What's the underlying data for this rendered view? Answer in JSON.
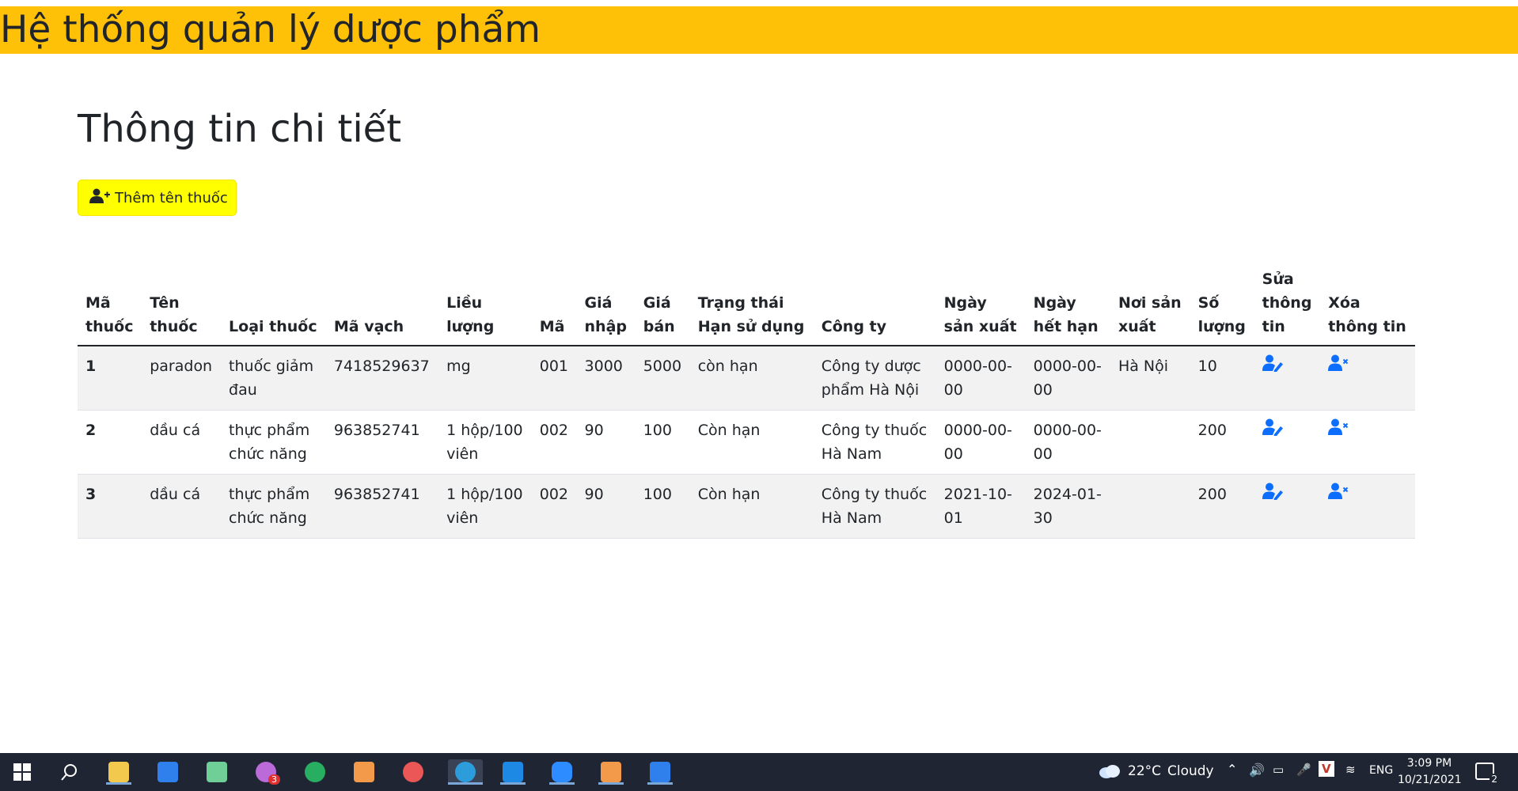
{
  "header": {
    "app_title": "Hệ thống quản lý dược phẩm",
    "bg_color": "#ffc107"
  },
  "main": {
    "title": "Thông tin chi tiết",
    "add_button": {
      "label": "Thêm tên thuốc",
      "icon": "user-plus-icon",
      "bg_color": "#ffff00"
    }
  },
  "table": {
    "headers": {
      "ma_thuoc": [
        "Mã",
        "thuốc"
      ],
      "ten_thuoc": [
        "Tên",
        "thuốc"
      ],
      "loai_thuoc": [
        "Loại thuốc"
      ],
      "ma_vach": [
        "Mã vạch"
      ],
      "lieu_luong": [
        "Liều",
        "lượng"
      ],
      "ma": [
        "Mã"
      ],
      "gia_nhap": [
        "Giá",
        "nhập"
      ],
      "gia_ban": [
        "Giá",
        "bán"
      ],
      "trang_thai": [
        "Trạng thái",
        "Hạn sử dụng"
      ],
      "cong_ty": [
        "Công ty"
      ],
      "ngay_sx": [
        "Ngày",
        "sản xuất"
      ],
      "ngay_hh": [
        "Ngày",
        "hết hạn"
      ],
      "noi_sx": [
        "Nơi sản",
        "xuất"
      ],
      "so_luong": [
        "Số",
        "lượng"
      ],
      "sua": [
        "Sửa",
        "thông",
        "tin"
      ],
      "xoa": [
        "Xóa",
        "thông tin"
      ]
    },
    "rows": [
      {
        "ma_thuoc": "1",
        "ten_thuoc": "paradon",
        "loai_thuoc": [
          "thuốc giảm",
          "đau"
        ],
        "ma_vach": "7418529637",
        "lieu_luong": [
          "mg"
        ],
        "ma": "001",
        "gia_nhap": "3000",
        "gia_ban": "5000",
        "trang_thai": "còn hạn",
        "cong_ty": [
          "Công ty dược",
          "phẩm Hà Nội"
        ],
        "ngay_sx": [
          "0000-00-",
          "00"
        ],
        "ngay_hh": [
          "0000-00-",
          "00"
        ],
        "noi_sx": "Hà Nội",
        "so_luong": "10"
      },
      {
        "ma_thuoc": "2",
        "ten_thuoc": "dầu cá",
        "loai_thuoc": [
          "thực phẩm",
          "chức năng"
        ],
        "ma_vach": "963852741",
        "lieu_luong": [
          "1 hộp/100",
          "viên"
        ],
        "ma": "002",
        "gia_nhap": "90",
        "gia_ban": "100",
        "trang_thai": "Còn hạn",
        "cong_ty": [
          "Công ty thuốc",
          "Hà Nam"
        ],
        "ngay_sx": [
          "0000-00-",
          "00"
        ],
        "ngay_hh": [
          "0000-00-",
          "00"
        ],
        "noi_sx": "",
        "so_luong": "200"
      },
      {
        "ma_thuoc": "3",
        "ten_thuoc": "dầu cá",
        "loai_thuoc": [
          "thực phẩm",
          "chức năng"
        ],
        "ma_vach": "963852741",
        "lieu_luong": [
          "1 hộp/100",
          "viên"
        ],
        "ma": "002",
        "gia_nhap": "90",
        "gia_ban": "100",
        "trang_thai": "Còn hạn",
        "cong_ty": [
          "Công ty thuốc",
          "Hà Nam"
        ],
        "ngay_sx": [
          "2021-10-",
          "01"
        ],
        "ngay_hh": [
          "2024-01-",
          "30"
        ],
        "noi_sx": "",
        "so_luong": "200"
      }
    ],
    "action_icons": {
      "edit": "user-edit-icon",
      "delete": "user-delete-icon",
      "color": "#0d6efd"
    }
  },
  "taskbar": {
    "apps": [
      "windows-start-icon",
      "search-icon",
      "file-explorer-icon",
      "mail-icon",
      "snipping-tool-icon",
      "messenger-icon",
      "coccoc-icon",
      "xampp-icon",
      "chrome-icon",
      "edge-icon",
      "vscode-icon",
      "zoom-icon",
      "foxit-icon",
      "media-player-icon"
    ],
    "messenger_badge": "3",
    "weather": {
      "temp": "22°C",
      "condition": "Cloudy"
    },
    "language": "ENG",
    "time": "3:09 PM",
    "date": "10/21/2021",
    "notification_count": "2"
  }
}
